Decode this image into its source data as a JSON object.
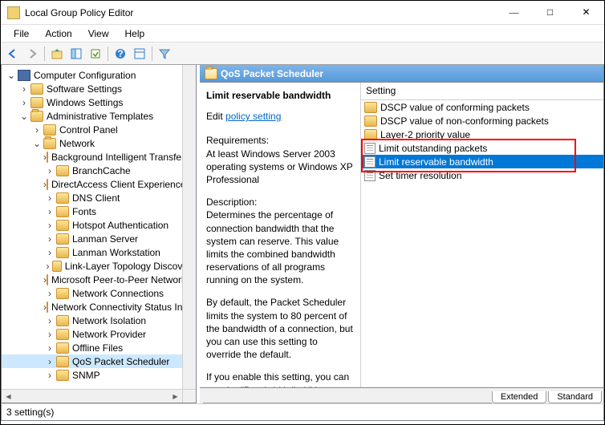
{
  "window": {
    "title": "Local Group Policy Editor"
  },
  "menu": {
    "file": "File",
    "action": "Action",
    "view": "View",
    "help": "Help"
  },
  "tree": {
    "root": "Computer Configuration",
    "software": "Software Settings",
    "windows": "Windows Settings",
    "admin": "Administrative Templates",
    "cp": "Control Panel",
    "network": "Network",
    "items": [
      "Background Intelligent Transfer Service",
      "BranchCache",
      "DirectAccess Client Experience Settings",
      "DNS Client",
      "Fonts",
      "Hotspot Authentication",
      "Lanman Server",
      "Lanman Workstation",
      "Link-Layer Topology Discovery",
      "Microsoft Peer-to-Peer Networking Services",
      "Network Connections",
      "Network Connectivity Status Indicator",
      "Network Isolation",
      "Network Provider",
      "Offline Files",
      "QoS Packet Scheduler",
      "SNMP"
    ]
  },
  "pane": {
    "header": "QoS Packet Scheduler",
    "setting_name": "Limit reservable bandwidth",
    "edit": "Edit",
    "policy_link": "policy setting",
    "reqs_label": "Requirements:",
    "reqs_text": "At least Windows Server 2003 operating systems or Windows XP Professional",
    "desc_label": "Description:",
    "desc_text": "Determines the percentage of connection bandwidth that the system can reserve. This value limits the combined bandwidth reservations of all programs running on the system.",
    "desc_text2": "By default, the Packet Scheduler limits the system to 80 percent of the bandwidth of a connection, but you can use this setting to override the default.",
    "desc_text3": "If you enable this setting, you can use the \"Bandwidth limit\" box to"
  },
  "list": {
    "header": "Setting",
    "folders": [
      "DSCP value of conforming packets",
      "DSCP value of non-conforming packets",
      "Layer-2 priority value"
    ],
    "policies": [
      "Limit outstanding packets",
      "Limit reservable bandwidth",
      "Set timer resolution"
    ],
    "selected": 1
  },
  "tabs": {
    "extended": "Extended",
    "standard": "Standard"
  },
  "status": "3 setting(s)"
}
